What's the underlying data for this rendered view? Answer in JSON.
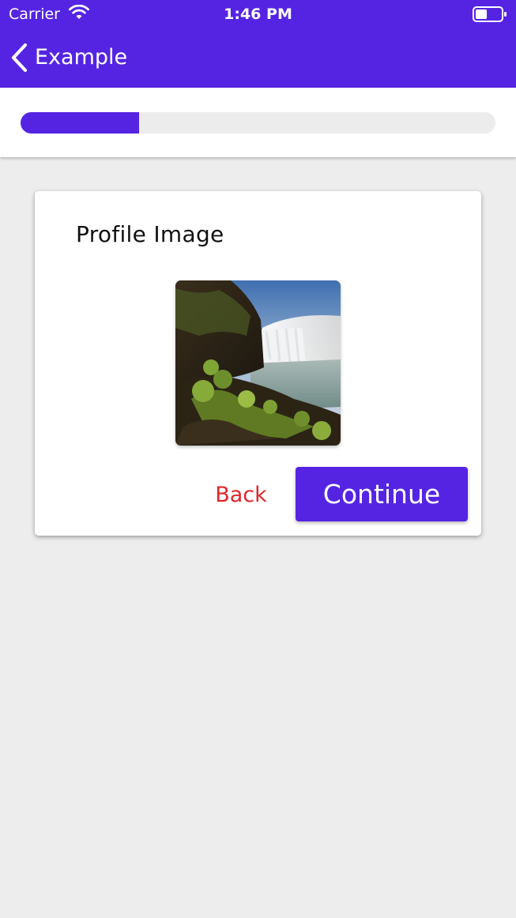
{
  "status_bar": {
    "carrier": "Carrier",
    "time": "1:46 PM",
    "wifi_icon": "wifi-icon",
    "battery_icon": "battery-icon"
  },
  "nav": {
    "back_label": "Example",
    "back_icon": "chevron-left-icon"
  },
  "progress": {
    "value": 0.25
  },
  "card": {
    "title": "Profile Image",
    "image_description": "waterfall-landscape-photo",
    "back_label": "Back",
    "continue_label": "Continue"
  },
  "colors": {
    "accent": "#5524e3",
    "back_text": "#e0252a",
    "background": "#ededed",
    "card": "#ffffff",
    "progress_track": "#ececec"
  }
}
